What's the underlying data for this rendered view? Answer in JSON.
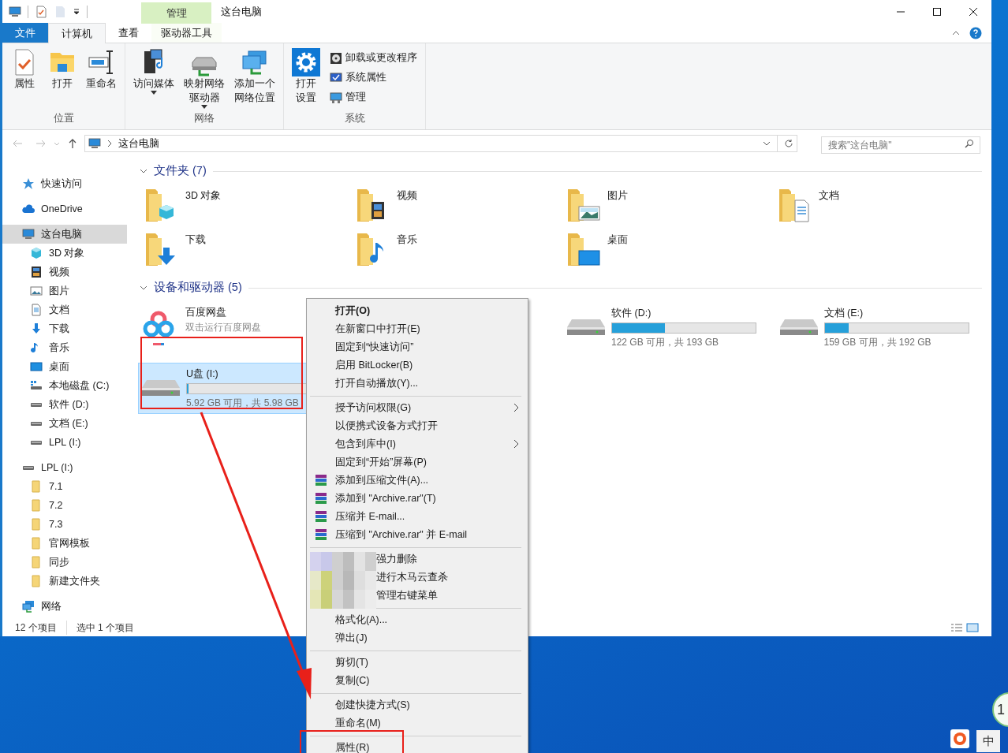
{
  "window": {
    "title": "这台电脑"
  },
  "context_header": "管理",
  "tabs": [
    {
      "label": "文件",
      "kind": "file",
      "selected": false
    },
    {
      "label": "计算机",
      "kind": "normal",
      "selected": true
    },
    {
      "label": "查看",
      "kind": "normal",
      "selected": false
    },
    {
      "label": "驱动器工具",
      "kind": "contextual",
      "selected": false
    }
  ],
  "ribbon_groups": [
    {
      "label": "位置",
      "buttons": [
        {
          "lines": [
            "属性"
          ],
          "kind": "properties",
          "dropdown": false
        },
        {
          "lines": [
            "打开"
          ],
          "kind": "folder",
          "dropdown": false
        },
        {
          "lines": [
            "重命名"
          ],
          "kind": "rename",
          "dropdown": false
        }
      ]
    },
    {
      "label": "网络",
      "buttons": [
        {
          "lines": [
            "访问媒体"
          ],
          "kind": "media",
          "dropdown": true
        },
        {
          "lines": [
            "映射网络",
            "驱动器"
          ],
          "kind": "netdrive",
          "dropdown": true
        },
        {
          "lines": [
            "添加一个",
            "网络位置"
          ],
          "kind": "netlocation",
          "dropdown": false
        }
      ]
    },
    {
      "label": "系统",
      "buttons": [
        {
          "lines": [
            "打开",
            "设置"
          ],
          "kind": "settings",
          "dropdown": false
        }
      ],
      "small_buttons": [
        {
          "label": "卸载或更改程序",
          "kind": "uninstall"
        },
        {
          "label": "系统属性",
          "kind": "sysprops"
        },
        {
          "label": "管理",
          "kind": "manage"
        }
      ]
    }
  ],
  "address": {
    "path": "这台电脑"
  },
  "search": {
    "placeholder": "搜索\"这台电脑\""
  },
  "nav": [
    {
      "label": "快速访问",
      "kind": "star",
      "selected": false
    },
    {
      "label": "OneDrive",
      "kind": "cloud",
      "selected": false
    },
    {
      "label": "这台电脑",
      "kind": "pc",
      "selected": true,
      "children": [
        {
          "label": "3D 对象",
          "kind": "cube",
          "selected": false
        },
        {
          "label": "视频",
          "kind": "video",
          "selected": false
        },
        {
          "label": "图片",
          "kind": "image",
          "selected": false
        },
        {
          "label": "文档",
          "kind": "doc",
          "selected": false
        },
        {
          "label": "下载",
          "kind": "download",
          "selected": false
        },
        {
          "label": "音乐",
          "kind": "music",
          "selected": false
        },
        {
          "label": "桌面",
          "kind": "desktop",
          "selected": false
        },
        {
          "label": "本地磁盘 (C:)",
          "kind": "sysdrive",
          "selected": false
        },
        {
          "label": "软件 (D:)",
          "kind": "drive",
          "selected": false
        },
        {
          "label": "文档 (E:)",
          "kind": "drive",
          "selected": false
        },
        {
          "label": "LPL (I:)",
          "kind": "drive",
          "selected": false
        }
      ]
    },
    {
      "label": "LPL (I:)",
      "kind": "drive",
      "selected": false,
      "children": [
        {
          "label": "7.1",
          "kind": "folder",
          "selected": false
        },
        {
          "label": "7.2",
          "kind": "folder",
          "selected": false
        },
        {
          "label": "7.3",
          "kind": "folder",
          "selected": false
        },
        {
          "label": "官网模板",
          "kind": "folder",
          "selected": false
        },
        {
          "label": "同步",
          "kind": "folder",
          "selected": false
        },
        {
          "label": "新建文件夹",
          "kind": "folder",
          "selected": false
        }
      ]
    },
    {
      "label": "网络",
      "kind": "network",
      "selected": false
    }
  ],
  "folders": {
    "title": "文件夹 (7)",
    "items": [
      {
        "name": "3D 对象",
        "kind": "cube"
      },
      {
        "name": "视频",
        "kind": "video"
      },
      {
        "name": "图片",
        "kind": "image"
      },
      {
        "name": "文档",
        "kind": "doc"
      },
      {
        "name": "下载",
        "kind": "download"
      },
      {
        "name": "音乐",
        "kind": "music"
      },
      {
        "name": "桌面",
        "kind": "desktop"
      }
    ]
  },
  "drives": {
    "title": "设备和驱动器 (5)",
    "items": [
      {
        "kind": "app",
        "name": "百度网盘",
        "subtitle": "双击运行百度网盘",
        "selected": false
      },
      {
        "kind": "drive",
        "name": "软件 (D:)",
        "level": 0.37,
        "free": "122 GB 可用，共 193 GB",
        "selected": false
      },
      {
        "kind": "drive",
        "name": "文档 (E:)",
        "level": 0.17,
        "free": "159 GB 可用，共 192 GB",
        "selected": false
      },
      {
        "kind": "drive",
        "name": "U盘 (I:)",
        "level": 0.01,
        "free": "5.92 GB 可用，共 5.98 GB",
        "selected": true
      }
    ]
  },
  "status_bar": [
    "12 个项目",
    "选中 1 个项目"
  ],
  "context_menu": [
    {
      "kind": "item",
      "label": "打开(O)",
      "bold": true,
      "submenu": false
    },
    {
      "kind": "item",
      "label": "在新窗口中打开(E)",
      "bold": false,
      "submenu": false
    },
    {
      "kind": "item",
      "label": "固定到“快速访问”",
      "bold": false,
      "submenu": false
    },
    {
      "kind": "item",
      "label": "启用 BitLocker(B)",
      "bold": false,
      "submenu": false
    },
    {
      "kind": "item",
      "label": "打开自动播放(Y)...",
      "bold": false,
      "submenu": false
    },
    {
      "kind": "separator"
    },
    {
      "kind": "item",
      "label": "授予访问权限(G)",
      "bold": false,
      "submenu": true
    },
    {
      "kind": "item",
      "label": "以便携式设备方式打开",
      "bold": false,
      "submenu": false
    },
    {
      "kind": "item",
      "label": "包含到库中(I)",
      "bold": false,
      "submenu": true
    },
    {
      "kind": "item",
      "label": "固定到“开始”屏幕(P)",
      "bold": false,
      "submenu": false
    },
    {
      "kind": "rar",
      "label": "添加到压缩文件(A)...",
      "bold": false,
      "submenu": false
    },
    {
      "kind": "rar",
      "label": "添加到 \"Archive.rar\"(T)",
      "bold": false,
      "submenu": false
    },
    {
      "kind": "rar",
      "label": "压缩并 E-mail...",
      "bold": false,
      "submenu": false
    },
    {
      "kind": "rar",
      "label": "压缩到 \"Archive.rar\" 并 E-mail",
      "bold": false,
      "submenu": false
    },
    {
      "kind": "separator"
    },
    {
      "kind": "blurred",
      "labels": [
        "强力删除",
        "进行木马云查杀",
        "管理右键菜单"
      ]
    },
    {
      "kind": "separator"
    },
    {
      "kind": "item",
      "label": "格式化(A)...",
      "bold": false,
      "submenu": false
    },
    {
      "kind": "item",
      "label": "弹出(J)",
      "bold": false,
      "submenu": false
    },
    {
      "kind": "separator"
    },
    {
      "kind": "item",
      "label": "剪切(T)",
      "bold": false,
      "submenu": false
    },
    {
      "kind": "item",
      "label": "复制(C)",
      "bold": false,
      "submenu": false
    },
    {
      "kind": "separator"
    },
    {
      "kind": "item",
      "label": "创建快捷方式(S)",
      "bold": false,
      "submenu": false
    },
    {
      "kind": "item",
      "label": "重命名(M)",
      "bold": false,
      "submenu": false
    },
    {
      "kind": "separator"
    },
    {
      "kind": "item",
      "label": "属性(R)",
      "bold": false,
      "submenu": false
    }
  ],
  "desktop": {
    "widget": "1",
    "ime": "中"
  }
}
